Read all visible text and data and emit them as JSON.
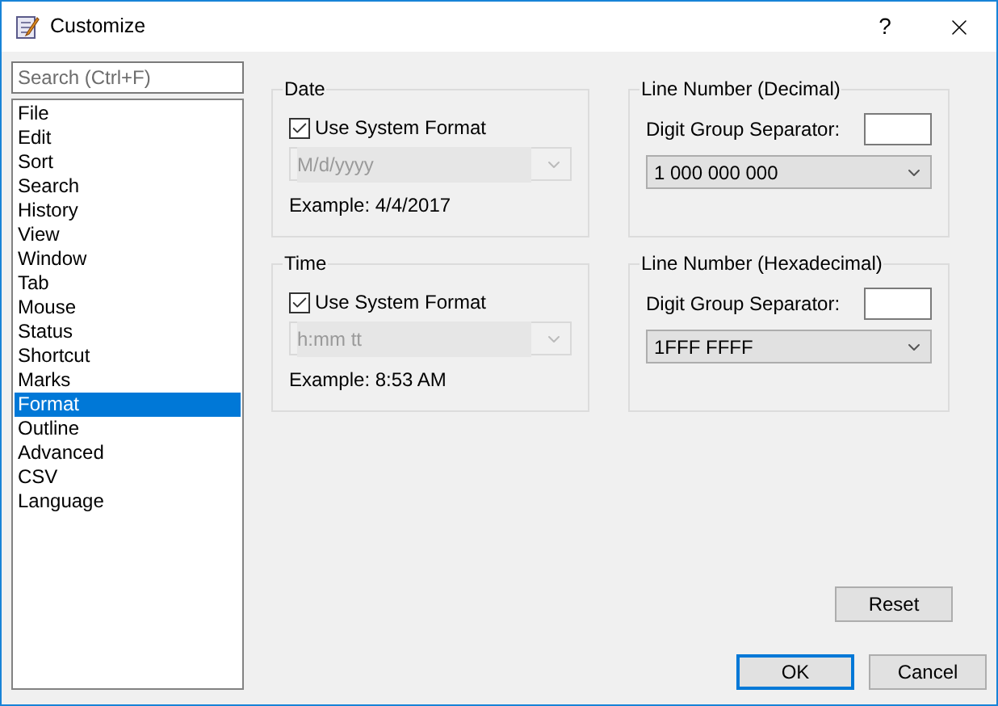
{
  "window": {
    "title": "Customize",
    "help": "?"
  },
  "search": {
    "placeholder": "Search (Ctrl+F)"
  },
  "categories": [
    {
      "label": "File",
      "selected": false
    },
    {
      "label": "Edit",
      "selected": false
    },
    {
      "label": "Sort",
      "selected": false
    },
    {
      "label": "Search",
      "selected": false
    },
    {
      "label": "History",
      "selected": false
    },
    {
      "label": "View",
      "selected": false
    },
    {
      "label": "Window",
      "selected": false
    },
    {
      "label": "Tab",
      "selected": false
    },
    {
      "label": "Mouse",
      "selected": false
    },
    {
      "label": "Status",
      "selected": false
    },
    {
      "label": "Shortcut",
      "selected": false
    },
    {
      "label": "Marks",
      "selected": false
    },
    {
      "label": "Format",
      "selected": true
    },
    {
      "label": "Outline",
      "selected": false
    },
    {
      "label": "Advanced",
      "selected": false
    },
    {
      "label": "CSV",
      "selected": false
    },
    {
      "label": "Language",
      "selected": false
    }
  ],
  "groups": [
    {
      "kind": "datetime",
      "title": "Date",
      "checkbox": {
        "label": "Use System Format",
        "checked": true
      },
      "dropdown": {
        "value": "M/d/yyyy",
        "disabled": true
      },
      "example": "Example: 4/4/2017"
    },
    {
      "kind": "number",
      "title": "Line Number (Decimal)",
      "separator_label": "Digit Group Separator:",
      "dropdown": {
        "value": "1 000 000 000",
        "disabled": false
      }
    },
    {
      "kind": "datetime",
      "title": "Time",
      "checkbox": {
        "label": "Use System Format",
        "checked": true
      },
      "dropdown": {
        "value": "h:mm tt",
        "disabled": true
      },
      "example": "Example: 8:53 AM"
    },
    {
      "kind": "number",
      "title": "Line Number (Hexadecimal)",
      "separator_label": "Digit Group Separator:",
      "dropdown": {
        "value": "1FFF FFFF",
        "disabled": false
      }
    }
  ],
  "buttons": {
    "reset": "Reset",
    "ok": "OK",
    "cancel": "Cancel"
  }
}
